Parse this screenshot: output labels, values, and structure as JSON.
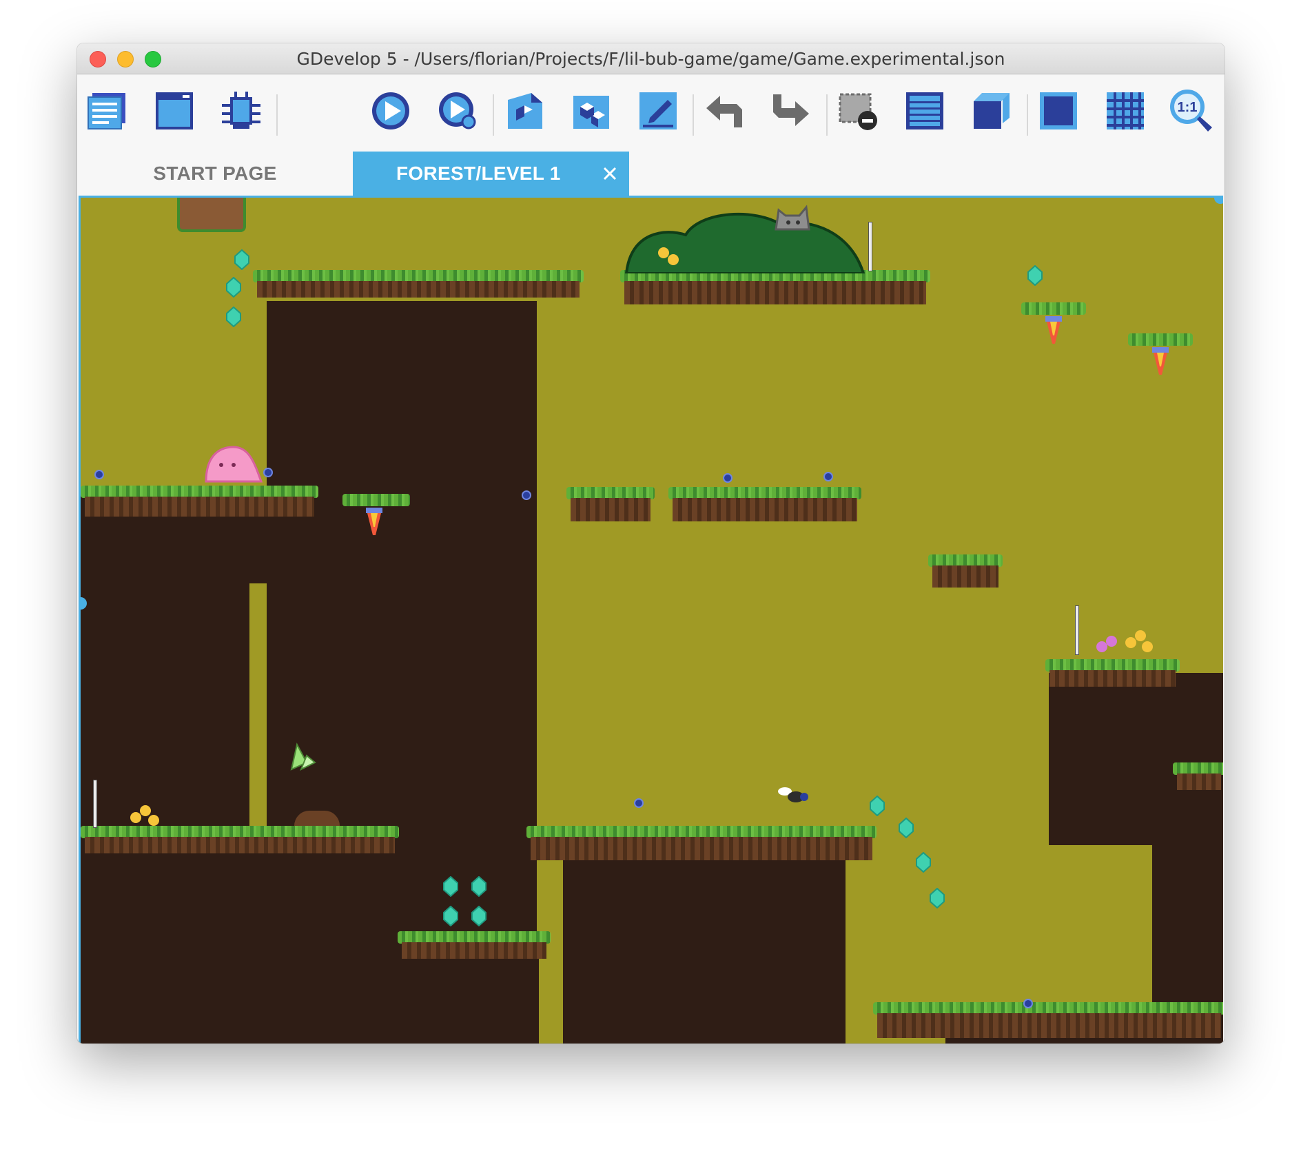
{
  "window": {
    "title": "GDevelop 5 - /Users/florian/Projects/F/lil-bub-game/game/Game.experimental.json"
  },
  "toolbar": {
    "buttons": [
      {
        "name": "project-manager-icon"
      },
      {
        "name": "scene-properties-icon"
      },
      {
        "name": "debugger-icon"
      },
      {
        "name": "preview-icon"
      },
      {
        "name": "network-preview-icon"
      },
      {
        "name": "objects-list-icon"
      },
      {
        "name": "object-groups-icon"
      },
      {
        "name": "properties-icon"
      },
      {
        "name": "undo-icon"
      },
      {
        "name": "redo-icon"
      },
      {
        "name": "delete-selection-icon"
      },
      {
        "name": "instances-list-icon"
      },
      {
        "name": "layers-icon"
      },
      {
        "name": "window-mask-icon"
      },
      {
        "name": "grid-icon"
      },
      {
        "name": "zoom-icon"
      }
    ],
    "zoom_label": "1:1"
  },
  "tabs": {
    "start_page": "START PAGE",
    "forest_level": "FOREST/LEVEL 1"
  },
  "colors": {
    "accent": "#4ab0e4",
    "scene_background": "#a09a25",
    "dirt": "#2f1d15",
    "grass": "#5fb039",
    "gem": "#3fd1b0",
    "player": "#f59ac8"
  }
}
